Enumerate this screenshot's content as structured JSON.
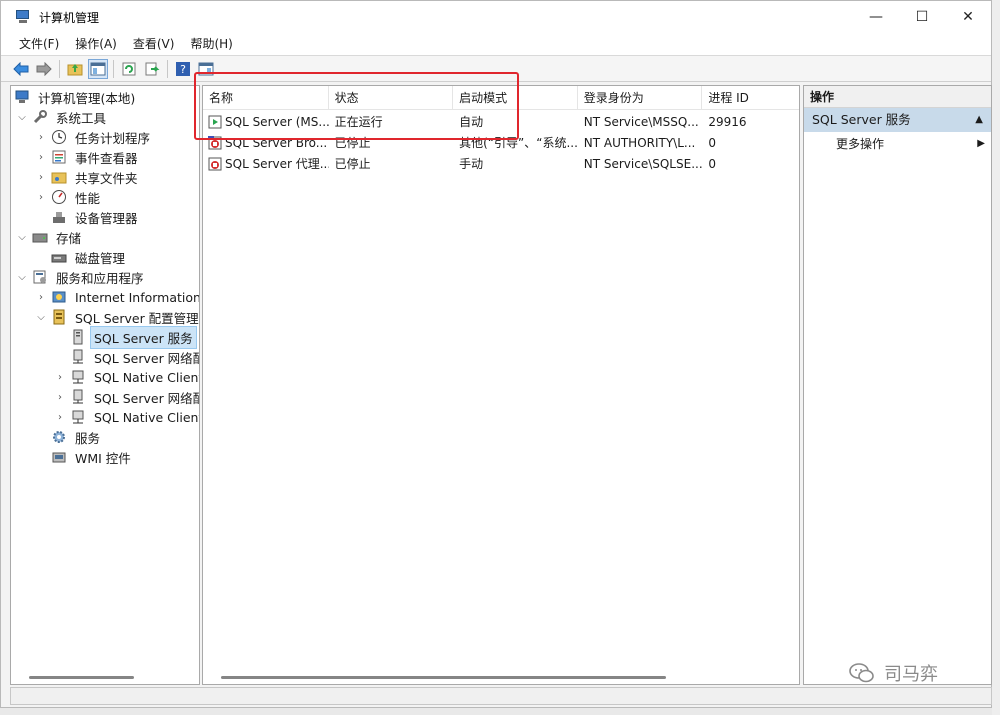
{
  "window": {
    "title": "计算机管理",
    "controls": {
      "minimize": "—",
      "maximize": "☐",
      "close": "✕"
    }
  },
  "menu": [
    "文件(F)",
    "操作(A)",
    "查看(V)",
    "帮助(H)"
  ],
  "tree": {
    "root": "计算机管理(本地)",
    "items": [
      {
        "label": "系统工具",
        "icon": "tools-icon"
      },
      {
        "label": "任务计划程序",
        "icon": "clock-icon"
      },
      {
        "label": "事件查看器",
        "icon": "event-viewer-icon"
      },
      {
        "label": "共享文件夹",
        "icon": "shared-folder-icon"
      },
      {
        "label": "性能",
        "icon": "performance-icon"
      },
      {
        "label": "设备管理器",
        "icon": "device-manager-icon"
      },
      {
        "label": "存储",
        "icon": "storage-icon"
      },
      {
        "label": "磁盘管理",
        "icon": "disk-icon"
      },
      {
        "label": "服务和应用程序",
        "icon": "services-apps-icon"
      },
      {
        "label": "Internet Information S",
        "icon": "iis-icon"
      },
      {
        "label": "SQL Server 配置管理器",
        "icon": "sql-config-icon"
      },
      {
        "label": "SQL Server 服务",
        "icon": "sql-service-icon"
      },
      {
        "label": "SQL Server 网络配",
        "icon": "network-icon"
      },
      {
        "label": "SQL Native Client",
        "icon": "client-icon"
      },
      {
        "label": "SQL Server 网络配",
        "icon": "network-icon"
      },
      {
        "label": "SQL Native Client",
        "icon": "client-icon"
      },
      {
        "label": "服务",
        "icon": "gear-icon"
      },
      {
        "label": "WMI 控件",
        "icon": "wmi-icon"
      }
    ]
  },
  "list": {
    "columns": [
      "名称",
      "状态",
      "启动模式",
      "登录身份为",
      "进程 ID"
    ],
    "rows": [
      {
        "name": "SQL Server (MS...",
        "status": "正在运行",
        "mode": "自动",
        "logon": "NT Service\\MSSQ...",
        "pid": "29916",
        "state": "running"
      },
      {
        "name": "SQL Server Bro...",
        "status": "已停止",
        "mode": "其他(“引导”、“系统...",
        "logon": "NT AUTHORITY\\L...",
        "pid": "0",
        "state": "stopped"
      },
      {
        "name": "SQL Server 代理...",
        "status": "已停止",
        "mode": "手动",
        "logon": "NT Service\\SQLSE...",
        "pid": "0",
        "state": "stopped"
      }
    ]
  },
  "actions": {
    "header": "操作",
    "section": "SQL Server 服务",
    "more": "更多操作"
  },
  "watermark": "司马弈",
  "colors": {
    "highlight": "#e0262d",
    "selection": "#cce4f7",
    "action_section": "#c8daea"
  }
}
